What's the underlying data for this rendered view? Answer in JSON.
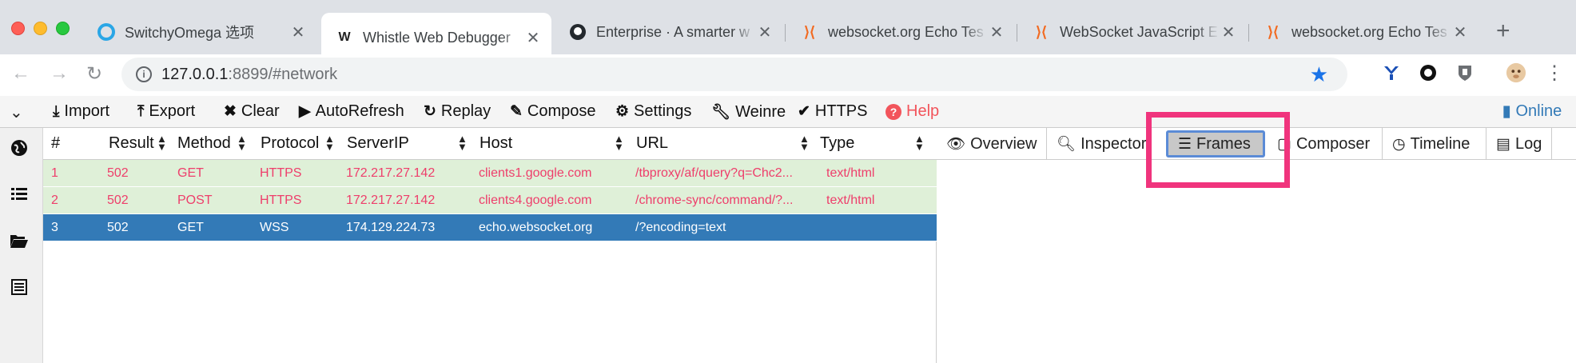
{
  "browser": {
    "tabs": [
      {
        "title": "SwitchyOmega 选项",
        "icon": "switchyomega-icon",
        "active": false
      },
      {
        "title": "Whistle Web Debugger",
        "icon": "whistle-icon",
        "active": true
      },
      {
        "title": "Enterprise · A smarter w",
        "icon": "github-icon",
        "active": false
      },
      {
        "title": "websocket.org Echo Tes",
        "icon": "websocket-icon",
        "active": false
      },
      {
        "title": "WebSocket JavaScript E",
        "icon": "websocket-icon",
        "active": false
      },
      {
        "title": "websocket.org Echo Tes",
        "icon": "websocket-icon",
        "active": false
      }
    ],
    "address": {
      "host": "127.0.0.1",
      "rest": ":8899/#network"
    }
  },
  "toolbar": {
    "import": "Import",
    "export": "Export",
    "clear": "Clear",
    "autorefresh": "AutoRefresh",
    "replay": "Replay",
    "compose": "Compose",
    "settings": "Settings",
    "weinre": "Weinre",
    "https": "HTTPS",
    "help": "Help",
    "online": "Online"
  },
  "table": {
    "columns": [
      "#",
      "Result",
      "Method",
      "Protocol",
      "ServerIP",
      "Host",
      "URL",
      "Type"
    ],
    "rows": [
      {
        "num": "1",
        "result": "502",
        "method": "GET",
        "protocol": "HTTPS",
        "ip": "172.217.27.142",
        "host": "clients1.google.com",
        "url": "/tbproxy/af/query?q=Chc2...",
        "type": "text/html",
        "state": "error"
      },
      {
        "num": "2",
        "result": "502",
        "method": "POST",
        "protocol": "HTTPS",
        "ip": "172.217.27.142",
        "host": "clients4.google.com",
        "url": "/chrome-sync/command/?...",
        "type": "text/html",
        "state": "error"
      },
      {
        "num": "3",
        "result": "502",
        "method": "GET",
        "protocol": "WSS",
        "ip": "174.129.224.73",
        "host": "echo.websocket.org",
        "url": "/?encoding=text",
        "type": "",
        "state": "selected"
      }
    ]
  },
  "detail_tabs": {
    "overview": "Overview",
    "inspector": "Inspector",
    "frames": "Frames",
    "composer": "Composer",
    "timeline": "Timeline",
    "log": "Log",
    "active": "Frames"
  },
  "colors": {
    "error_row_bg": "#dff0d8",
    "error_text": "#ee3e6b",
    "selected_row_bg": "#337ab7",
    "highlight": "#f0347d",
    "help": "#f2545b",
    "online": "#337ab7"
  }
}
